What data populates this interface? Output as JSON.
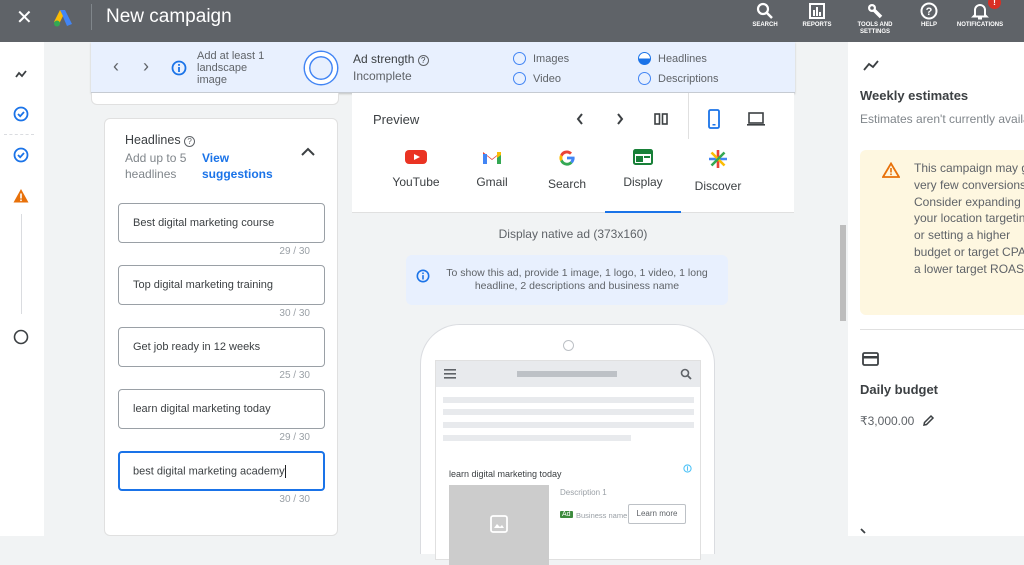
{
  "topbar": {
    "title": "New campaign",
    "close_icon": "close-icon",
    "logo": "google-ads-logo",
    "actions": [
      {
        "label": "SEARCH",
        "icon": "search-icon"
      },
      {
        "label": "REPORTS",
        "icon": "reports-icon"
      },
      {
        "label": "TOOLS AND SETTINGS",
        "icon": "wrench-icon"
      },
      {
        "label": "HELP",
        "icon": "help-icon"
      },
      {
        "label": "NOTIFICATIONS",
        "icon": "bell-icon",
        "badge": "!"
      }
    ]
  },
  "left_rail": {
    "steps": [
      {
        "icon": "trend-icon",
        "state": "overview"
      },
      {
        "icon": "check-circle-icon",
        "state": "complete"
      },
      {
        "icon": "check-circle-icon",
        "state": "complete"
      },
      {
        "icon": "warning-icon",
        "state": "warning"
      },
      {
        "icon": "circle-icon",
        "state": "pending"
      }
    ]
  },
  "ad_strength": {
    "hint": "Add at least 1 landscape image",
    "label": "Ad strength",
    "value": "Incomplete",
    "checklist": [
      {
        "label": "Images",
        "state": "empty"
      },
      {
        "label": "Video",
        "state": "empty"
      },
      {
        "label": "Headlines",
        "state": "half"
      },
      {
        "label": "Descriptions",
        "state": "empty"
      }
    ]
  },
  "headlines": {
    "title": "Headlines",
    "subtitle": "Add up to 5 headlines",
    "link": "View suggestions",
    "items": [
      {
        "value": "Best digital marketing course",
        "count": "29 / 30"
      },
      {
        "value": "Top digital marketing training",
        "count": "30 / 30"
      },
      {
        "value": "Get job ready in 12 weeks",
        "count": "25 / 30"
      },
      {
        "value": "learn digital marketing today",
        "count": "29 / 30"
      },
      {
        "value": "best digital marketing academy",
        "count": "30 / 30"
      }
    ]
  },
  "preview": {
    "title": "Preview",
    "tabs": [
      {
        "label": "YouTube",
        "icon": "youtube-icon"
      },
      {
        "label": "Gmail",
        "icon": "gmail-icon"
      },
      {
        "label": "Search",
        "icon": "google-icon"
      },
      {
        "label": "Display",
        "icon": "display-icon",
        "active": true
      },
      {
        "label": "Discover",
        "icon": "discover-icon"
      }
    ],
    "ad_type": "Display native ad (373x160)",
    "info": "To show this ad, provide 1 image, 1 logo, 1 video, 1 long headline, 2 descriptions and business name",
    "mock": {
      "headline": "learn digital marketing today",
      "description": "Description 1",
      "badge": "Ad",
      "business": "Business name",
      "cta": "Learn more"
    }
  },
  "right_panel": {
    "weekly_title": "Weekly estimates",
    "weekly_sub": "Estimates aren't currently available",
    "warning": "This campaign may get very few conversions. Consider expanding your location targeting, or setting a higher budget or target CPA or a lower target ROAS.",
    "budget_title": "Daily budget",
    "budget_value": "₹3,000.00"
  }
}
